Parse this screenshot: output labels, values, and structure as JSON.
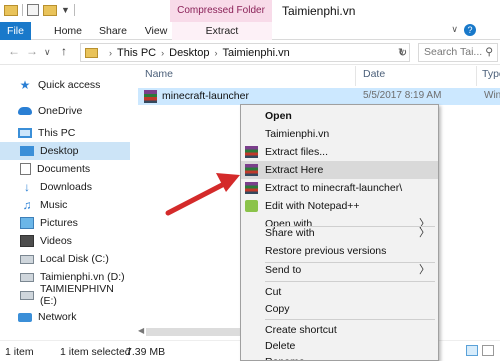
{
  "title_bar": {
    "context_tab": "Compressed Folder Tools",
    "window_title": "Taimienphi.vn"
  },
  "ribbon": {
    "tabs": [
      "File",
      "Home",
      "Share",
      "View",
      "Extract"
    ]
  },
  "address_bar": {
    "crumbs": [
      "This PC",
      "Desktop",
      "Taimienphi.vn"
    ],
    "search_placeholder": "Search Tai..."
  },
  "sidebar": {
    "items": [
      {
        "label": "Quick access",
        "icon": "star-icon"
      },
      {
        "label": "OneDrive",
        "icon": "cloud-icon"
      },
      {
        "label": "This PC",
        "icon": "computer-icon"
      },
      {
        "label": "Desktop",
        "icon": "desktop-icon",
        "selected": true
      },
      {
        "label": "Documents",
        "icon": "documents-icon"
      },
      {
        "label": "Downloads",
        "icon": "downloads-icon"
      },
      {
        "label": "Music",
        "icon": "music-icon"
      },
      {
        "label": "Pictures",
        "icon": "pictures-icon"
      },
      {
        "label": "Videos",
        "icon": "videos-icon"
      },
      {
        "label": "Local Disk (C:)",
        "icon": "drive-icon"
      },
      {
        "label": "Taimienphi.vn (D:)",
        "icon": "drive-icon"
      },
      {
        "label": "TAIMIENPHIVN (E:)",
        "icon": "drive-icon"
      },
      {
        "label": "Network",
        "icon": "network-icon"
      }
    ]
  },
  "file_list": {
    "columns": [
      "Name",
      "Date",
      "Type"
    ],
    "rows": [
      {
        "name": "minecraft-launcher",
        "date": "5/5/2017 8:19 AM",
        "type": "WinR"
      }
    ]
  },
  "context_menu": {
    "items": [
      "Open",
      "Taimienphi.vn",
      "Extract files...",
      "Extract Here",
      "Extract to minecraft-launcher\\",
      "Edit with Notepad++",
      "Open with",
      "Share with",
      "Restore previous versions",
      "Send to",
      "Cut",
      "Copy",
      "Create shortcut",
      "Delete",
      "Rename"
    ]
  },
  "status_bar": {
    "count": "1 item",
    "selected": "1 item selected",
    "size": "7.39 MB"
  },
  "colors": {
    "file_tab": "#1979ca",
    "context_tab_bg": "#f8dbe9",
    "selection": "#cce4f7",
    "annotation_arrow": "#d42a2a"
  }
}
